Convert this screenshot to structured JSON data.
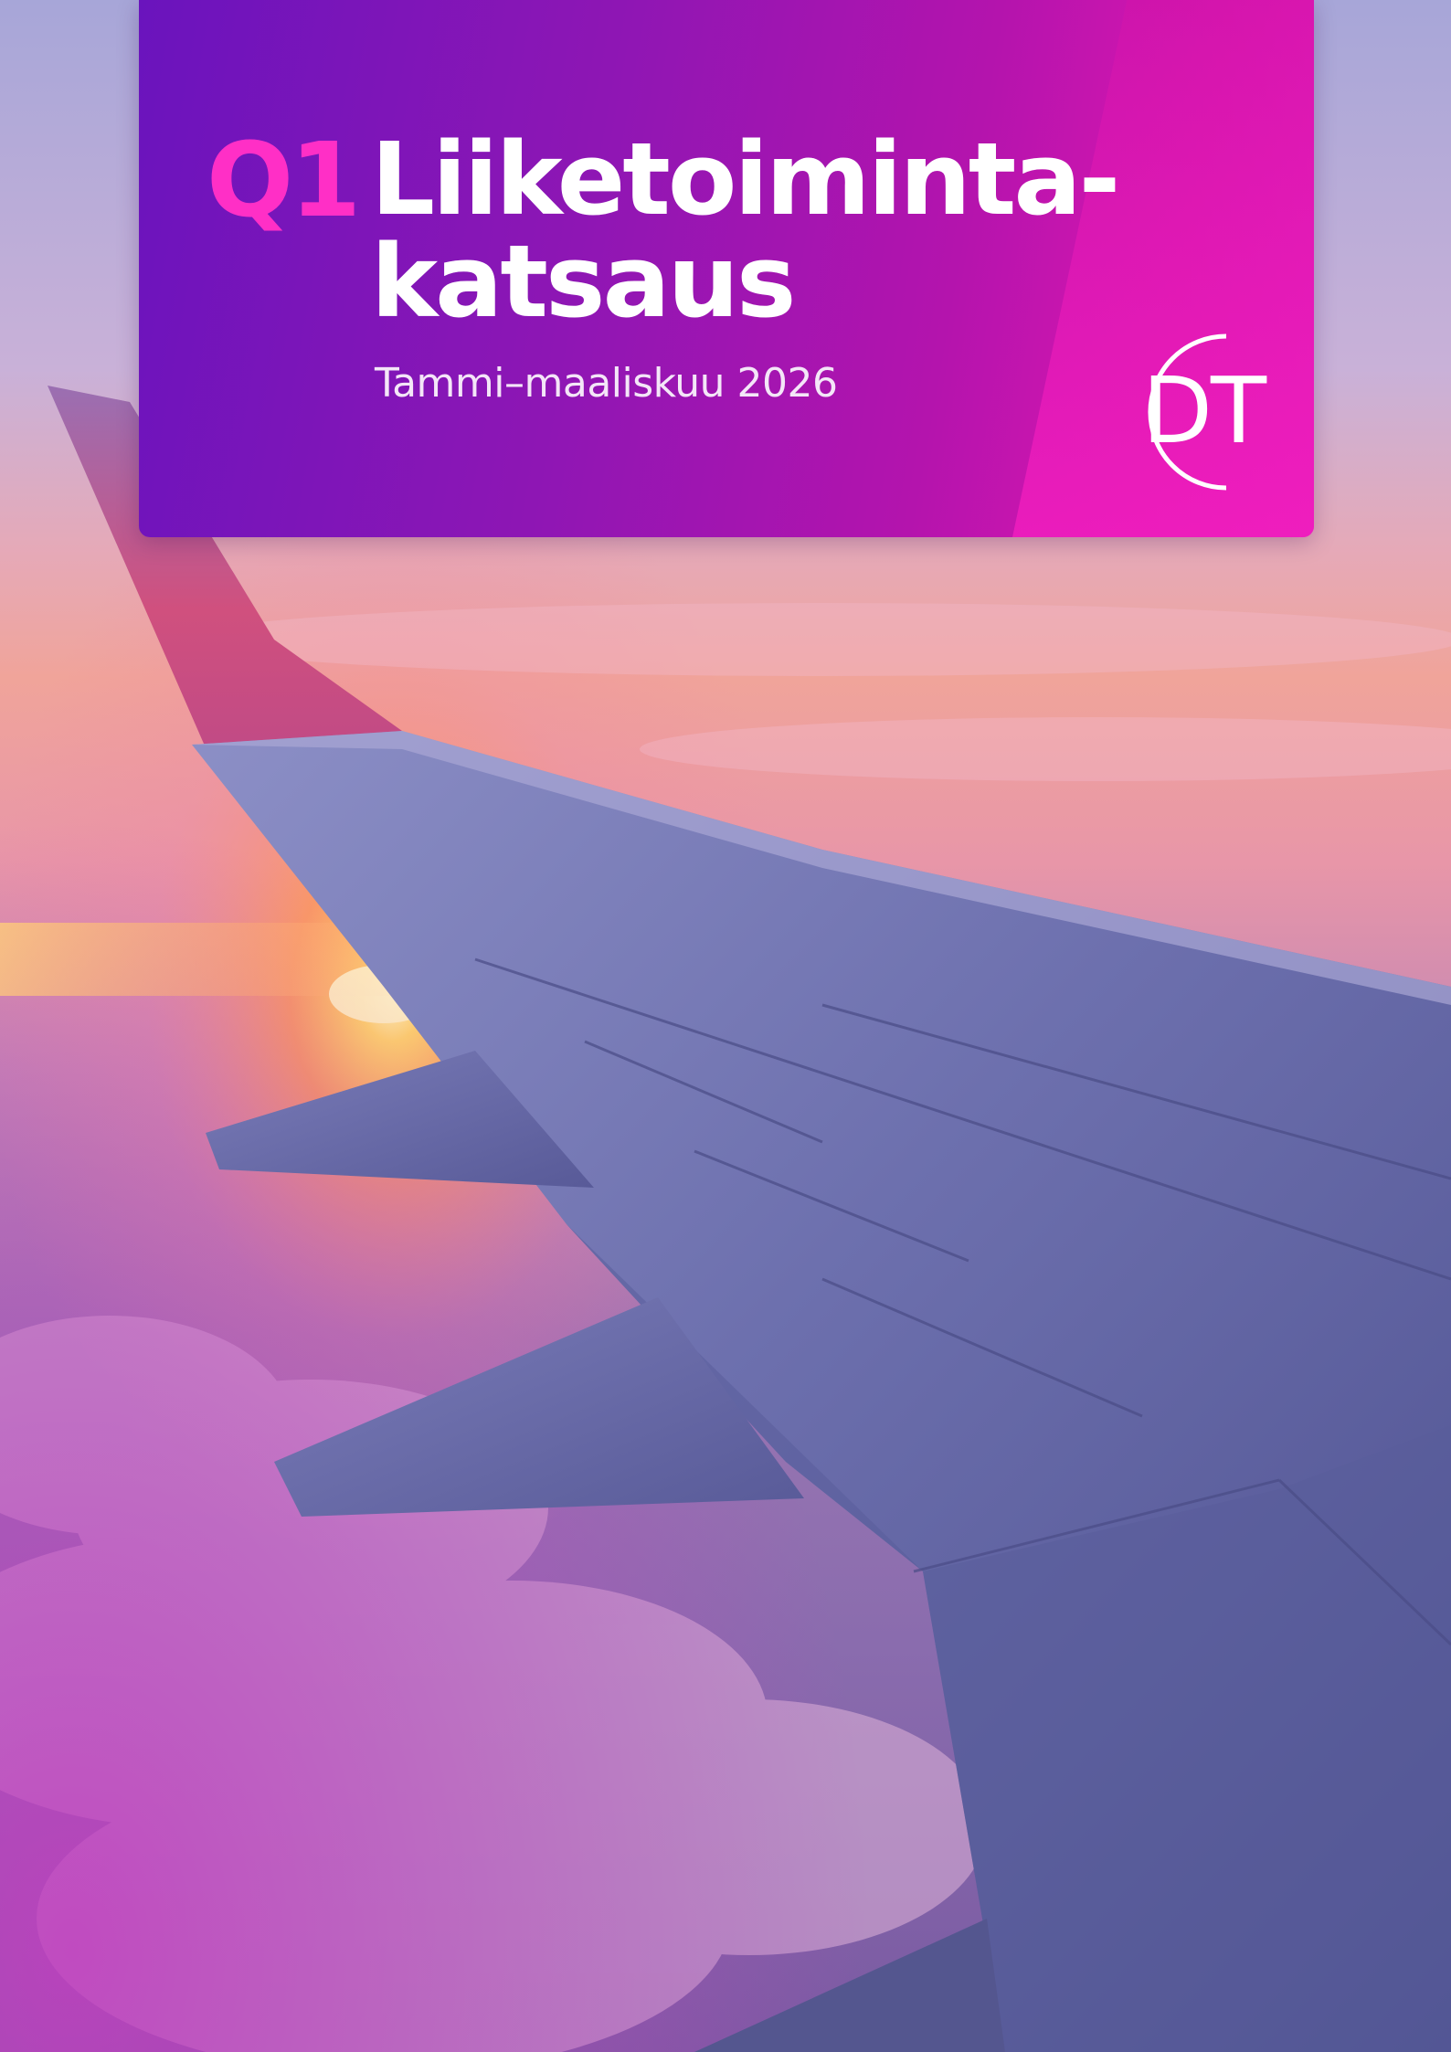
{
  "cover": {
    "quarter": "Q1",
    "title_line_1": "Liiketoiminta-",
    "title_line_2": "katsaus",
    "period": "Tammi–maaliskuu 2026",
    "logo_text": "DT",
    "photo": "airplane-wing-sunset-photo"
  },
  "colors": {
    "panel_start": "#6a14bd",
    "panel_end": "#e81cbc",
    "accent_magenta": "#ff2fc6",
    "text_white": "#ffffff"
  }
}
